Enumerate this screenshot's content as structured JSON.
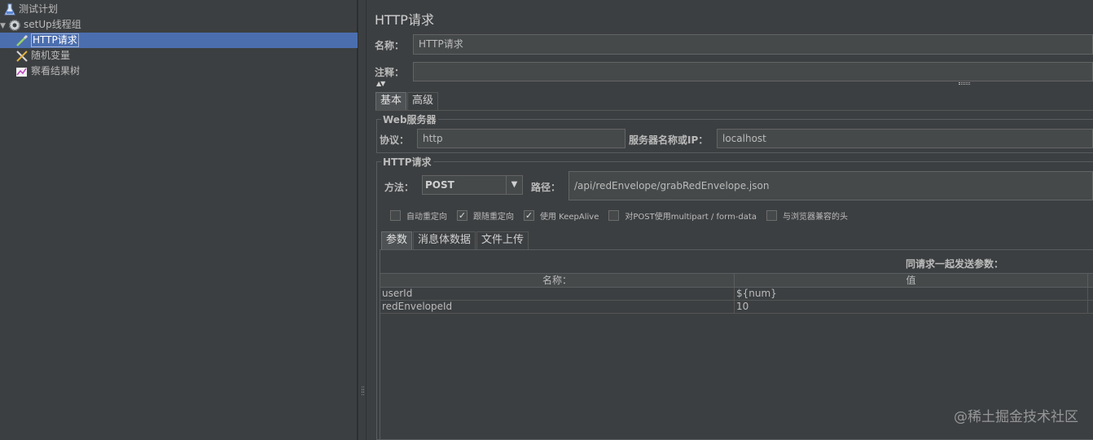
{
  "tree": {
    "items": [
      {
        "label": "测试计划",
        "icon": "flask-icon"
      },
      {
        "label": "setUp线程组",
        "icon": "gear-icon"
      },
      {
        "label": "HTTP请求",
        "icon": "pipette-icon",
        "selected": true
      },
      {
        "label": "随机变量",
        "icon": "tools-icon"
      },
      {
        "label": "察看结果树",
        "icon": "chart-icon"
      }
    ]
  },
  "panel": {
    "title": "HTTP请求",
    "name_label": "名称：",
    "name_value": "HTTP请求",
    "comment_label": "注释：",
    "comment_value": "",
    "tabs": [
      "基本",
      "高级"
    ],
    "web_server": {
      "section_title": "Web服务器",
      "protocol_label": "协议：",
      "protocol_value": "http",
      "server_label": "服务器名称或IP：",
      "server_value": "localhost"
    },
    "http_request": {
      "section_title": "HTTP请求",
      "method_label": "方法：",
      "method_value": "POST",
      "path_label": "路径：",
      "path_value": "/api/redEnvelope/grabRedEnvelope.json"
    },
    "checkboxes": [
      {
        "label": "自动重定向",
        "checked": false
      },
      {
        "label": "跟随重定向",
        "checked": true
      },
      {
        "label": "使用 KeepAlive",
        "checked": true
      },
      {
        "label": "对POST使用multipart / form-data",
        "checked": false
      },
      {
        "label": "与浏览器兼容的头",
        "checked": false
      }
    ],
    "sub_tabs": [
      "参数",
      "消息体数据",
      "文件上传"
    ],
    "params": {
      "title": "同请求一起发送参数：",
      "columns": [
        "名称：",
        "值"
      ],
      "rows": [
        {
          "name": "userId",
          "value": "${num}"
        },
        {
          "name": "redEnvelopeId",
          "value": "10"
        }
      ]
    }
  },
  "watermark": "@稀土掘金技术社区",
  "colors": {
    "background": "#3c3f41",
    "selection": "#4b6eaf",
    "field": "#45494a"
  }
}
